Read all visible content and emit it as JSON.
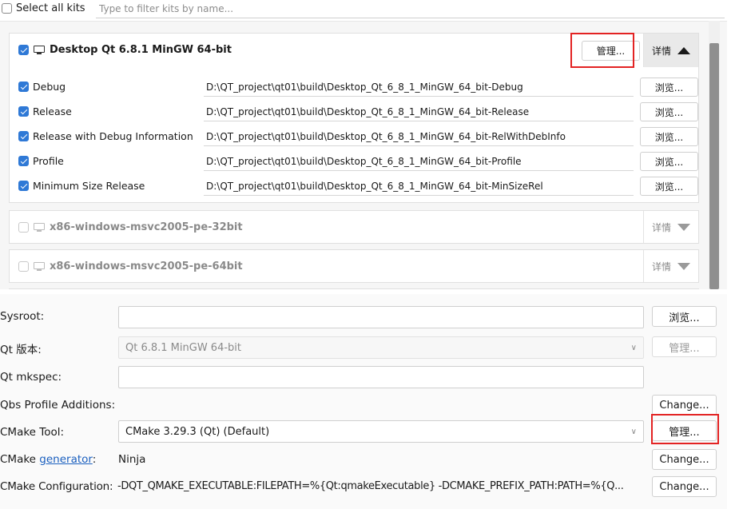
{
  "filter": {
    "select_all_label": "Select all kits",
    "placeholder": "Type to filter kits by name..."
  },
  "active_kit": {
    "name": "Desktop Qt 6.8.1 MinGW 64-bit",
    "manage_label": "管理...",
    "details_label": "详情",
    "build_configs": [
      {
        "name": "Debug",
        "path": "D:\\QT_project\\qt01\\build\\Desktop_Qt_6_8_1_MinGW_64_bit-Debug",
        "browse_label": "浏览..."
      },
      {
        "name": "Release",
        "path": "D:\\QT_project\\qt01\\build\\Desktop_Qt_6_8_1_MinGW_64_bit-Release",
        "browse_label": "浏览..."
      },
      {
        "name": "Release with Debug Information",
        "path": "D:\\QT_project\\qt01\\build\\Desktop_Qt_6_8_1_MinGW_64_bit-RelWithDebInfo",
        "browse_label": "浏览..."
      },
      {
        "name": "Profile",
        "path": "D:\\QT_project\\qt01\\build\\Desktop_Qt_6_8_1_MinGW_64_bit-Profile",
        "browse_label": "浏览..."
      },
      {
        "name": "Minimum Size Release",
        "path": "D:\\QT_project\\qt01\\build\\Desktop_Qt_6_8_1_MinGW_64_bit-MinSizeRel",
        "browse_label": "浏览..."
      }
    ]
  },
  "other_kits": [
    {
      "name": "x86-windows-msvc2005-pe-32bit",
      "details_label": "详情"
    },
    {
      "name": "x86-windows-msvc2005-pe-64bit",
      "details_label": "详情"
    }
  ],
  "settings": {
    "sysroot": {
      "label": "Sysroot:",
      "value": "",
      "button": "浏览..."
    },
    "qt_version": {
      "label": "Qt 版本:",
      "value": "Qt 6.8.1 MinGW 64-bit",
      "button": "管理..."
    },
    "qt_mkspec": {
      "label": "Qt mkspec:",
      "value": ""
    },
    "qbs_profile": {
      "label": "Qbs Profile Additions:",
      "button": "Change..."
    },
    "cmake_tool": {
      "label": "CMake Tool:",
      "value": "CMake 3.29.3 (Qt) (Default)",
      "button": "管理..."
    },
    "cmake_generator": {
      "label_prefix": "CMake ",
      "label_link": "generator",
      "label_suffix": ":",
      "value": "Ninja",
      "button": "Change..."
    },
    "cmake_configuration": {
      "label": "CMake Configuration:",
      "value": "-DQT_QMAKE_EXECUTABLE:FILEPATH=%{Qt:qmakeExecutable} -DCMAKE_PREFIX_PATH:PATH=%{Q...",
      "button": "Change..."
    }
  },
  "colors": {
    "accent": "#2f79d6",
    "highlight_box": "#e32323",
    "link": "#1a5fbf"
  }
}
